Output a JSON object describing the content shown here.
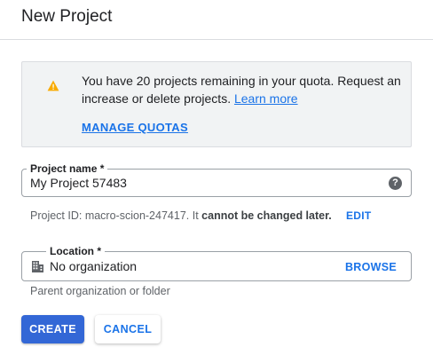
{
  "dialog": {
    "title": "New Project"
  },
  "quota_banner": {
    "icon": "warning-icon",
    "message": "You have 20 projects remaining in your quota. Request an increase or delete projects.",
    "learn_more": "Learn more",
    "manage_quotas": "MANAGE QUOTAS",
    "warning_color": "#f9ab00"
  },
  "project_name": {
    "label": "Project name *",
    "value": "My Project 57483",
    "help_icon": "help-icon"
  },
  "project_id": {
    "prefix": "Project ID: macro-scion-247417.",
    "it_text": "It",
    "warning": "cannot be changed later.",
    "edit": "EDIT"
  },
  "location": {
    "label": "Location *",
    "value": "No organization",
    "icon": "building-icon",
    "browse": "BROWSE",
    "hint": "Parent organization or folder"
  },
  "actions": {
    "create": "CREATE",
    "cancel": "CANCEL"
  },
  "colors": {
    "primary": "#1a73e8",
    "create_bg": "#3367d6"
  }
}
